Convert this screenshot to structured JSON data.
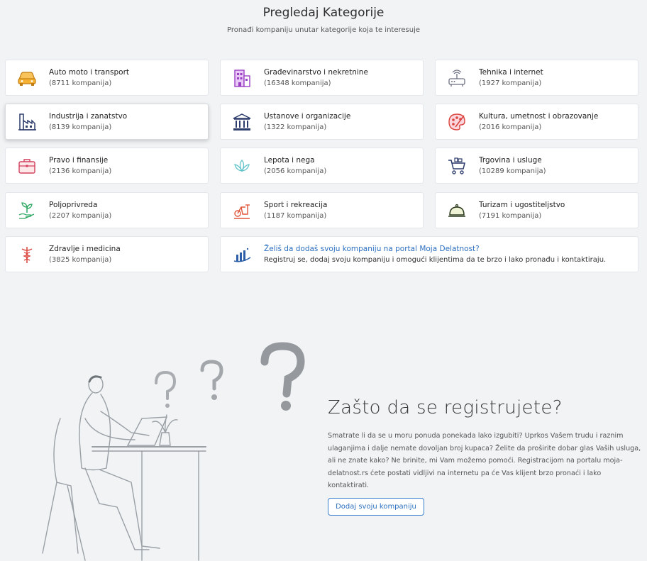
{
  "header": {
    "title": "Pregledaj Kategorije",
    "subtitle": "Pronađi kompaniju unutar kategorije koja te interesuje"
  },
  "categories": [
    {
      "name": "Auto moto i transport",
      "count": "(8711 kompanija)",
      "icon": "car-icon"
    },
    {
      "name": "Građevinarstvo i nekretnine",
      "count": "(16348 kompanija)",
      "icon": "building-icon"
    },
    {
      "name": "Tehnika i internet",
      "count": "(1927 kompanija)",
      "icon": "router-icon"
    },
    {
      "name": "Industrija i zanatstvo",
      "count": "(8139 kompanija)",
      "icon": "factory-icon"
    },
    {
      "name": "Ustanove i organizacije",
      "count": "(1322 kompanija)",
      "icon": "institution-icon"
    },
    {
      "name": "Kultura, umetnost i obrazovanje",
      "count": "(2016 kompanija)",
      "icon": "palette-icon"
    },
    {
      "name": "Pravo i finansije",
      "count": "(2136 kompanija)",
      "icon": "briefcase-icon"
    },
    {
      "name": "Lepota i nega",
      "count": "(2056 kompanija)",
      "icon": "lotus-icon"
    },
    {
      "name": "Trgovina i usluge",
      "count": "(10289 kompanija)",
      "icon": "cart-icon"
    },
    {
      "name": "Poljoprivreda",
      "count": "(2207 kompanija)",
      "icon": "plant-hand-icon"
    },
    {
      "name": "Sport i rekreacija",
      "count": "(1187 kompanija)",
      "icon": "exercise-bike-icon"
    },
    {
      "name": "Turizam i ugostiteljstvo",
      "count": "(7191 kompanija)",
      "icon": "cloche-icon"
    },
    {
      "name": "Zdravlje i medicina",
      "count": "(3825 kompanija)",
      "icon": "caduceus-icon"
    }
  ],
  "promo": {
    "title": "Želiš da dodaš svoju kompaniju na portal Moja Delatnost?",
    "text": "Registruj se, dodaj svoju kompaniju i omogući klijentima da te brzo i lako pronađu i kontaktiraju.",
    "icon": "growth-chart-icon"
  },
  "why": {
    "title": "Zašto da se registrujete?",
    "paragraph": "Smatrate li da se u moru ponuda ponekada lako izgubiti? Uprkos Vašem trudu i raznim ulaganjima i dalje nemate dovoljan broj kupaca? Želite da proširite dobar glas Vaših usluga, ali ne znate kako? Ne brinite, mi Vam možemo pomoći. Registracijom na portalu moja-delatnost.rs ćete postati vidljivi na internetu pa će Vas klijent brzo pronaći i lako kontaktirati.",
    "button": "Dodaj svoju kompaniju"
  },
  "colors": {
    "background": "#f1f3f5",
    "accent": "#2c6fbf",
    "icon_orange": "#e6a01e",
    "icon_purple": "#9b3fc4",
    "icon_navy": "#2d3d6b",
    "icon_red": "#d9443e",
    "icon_teal": "#5fc3c9",
    "icon_green": "#2ea862"
  }
}
